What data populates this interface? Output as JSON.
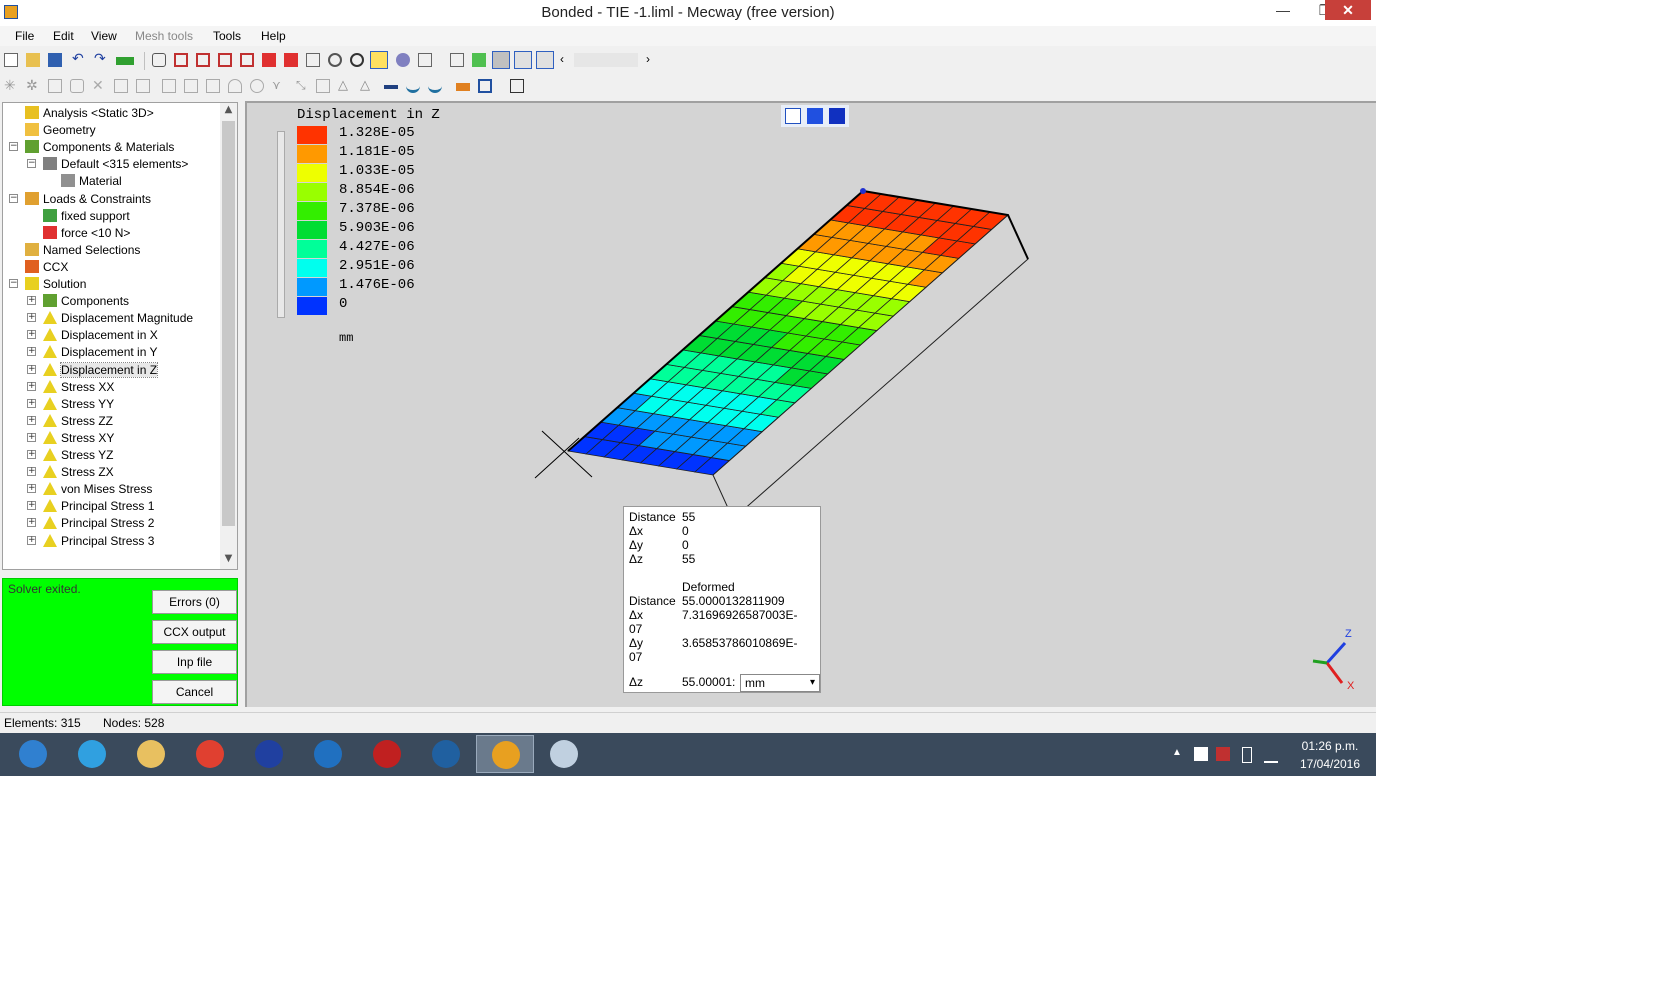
{
  "window": {
    "title": "Bonded - TIE -1.liml - Mecway (free version)",
    "minimize": "—",
    "maximize": "❐",
    "close": "✕"
  },
  "menu": [
    "File",
    "Edit",
    "View",
    "Mesh tools",
    "Tools",
    "Help"
  ],
  "tree": [
    {
      "label": "Analysis <Static 3D>",
      "level": 0,
      "icon": "analysis-icon",
      "color": "#e8c020"
    },
    {
      "label": "Geometry",
      "level": 0,
      "icon": "folder-icon",
      "color": "#f0c040"
    },
    {
      "label": "Components & Materials",
      "level": 0,
      "icon": "components-icon",
      "color": "#60a030",
      "expander": "-"
    },
    {
      "label": "Default <315 elements>",
      "level": 1,
      "icon": "component-icon",
      "color": "#808080",
      "expander": "-"
    },
    {
      "label": "Material",
      "level": 2,
      "icon": "material-icon",
      "color": "#909090"
    },
    {
      "label": "Loads & Constraints",
      "level": 0,
      "icon": "loads-icon",
      "color": "#e0a030",
      "expander": "-"
    },
    {
      "label": "fixed support",
      "level": 1,
      "icon": "fixed-support-icon",
      "color": "#40a040"
    },
    {
      "label": "force <10 N>",
      "level": 1,
      "icon": "force-icon",
      "color": "#e03030"
    },
    {
      "label": "Named Selections",
      "level": 0,
      "icon": "named-selections-icon",
      "color": "#e0b040"
    },
    {
      "label": "CCX",
      "level": 0,
      "icon": "ccx-icon",
      "color": "#e06020"
    },
    {
      "label": "Solution",
      "level": 0,
      "icon": "solution-icon",
      "color": "#e8d020",
      "expander": "-"
    },
    {
      "label": "Components",
      "level": 1,
      "icon": "components-icon",
      "color": "#60a030",
      "expander": "+"
    },
    {
      "label": "Displacement Magnitude",
      "level": 1,
      "icon": "result-icon",
      "color": "#e8d020",
      "expander": "+"
    },
    {
      "label": "Displacement in X",
      "level": 1,
      "icon": "result-icon",
      "color": "#e8d020",
      "expander": "+"
    },
    {
      "label": "Displacement in Y",
      "level": 1,
      "icon": "result-icon",
      "color": "#e8d020",
      "expander": "+"
    },
    {
      "label": "Displacement in Z",
      "level": 1,
      "icon": "result-icon",
      "color": "#e8d020",
      "expander": "+",
      "selected": true
    },
    {
      "label": "Stress XX",
      "level": 1,
      "icon": "result-icon",
      "color": "#e8d020",
      "expander": "+"
    },
    {
      "label": "Stress YY",
      "level": 1,
      "icon": "result-icon",
      "color": "#e8d020",
      "expander": "+"
    },
    {
      "label": "Stress ZZ",
      "level": 1,
      "icon": "result-icon",
      "color": "#e8d020",
      "expander": "+"
    },
    {
      "label": "Stress XY",
      "level": 1,
      "icon": "result-icon",
      "color": "#e8d020",
      "expander": "+"
    },
    {
      "label": "Stress YZ",
      "level": 1,
      "icon": "result-icon",
      "color": "#e8d020",
      "expander": "+"
    },
    {
      "label": "Stress ZX",
      "level": 1,
      "icon": "result-icon",
      "color": "#e8d020",
      "expander": "+"
    },
    {
      "label": "von Mises Stress",
      "level": 1,
      "icon": "result-icon",
      "color": "#e8d020",
      "expander": "+"
    },
    {
      "label": "Principal Stress 1",
      "level": 1,
      "icon": "result-icon",
      "color": "#e8d020",
      "expander": "+"
    },
    {
      "label": "Principal Stress 2",
      "level": 1,
      "icon": "result-icon",
      "color": "#e8d020",
      "expander": "+"
    },
    {
      "label": "Principal Stress 3",
      "level": 1,
      "icon": "result-icon",
      "color": "#e8d020",
      "expander": "+"
    }
  ],
  "solver": {
    "status": "Solver exited.",
    "buttons": [
      "Errors (0)",
      "CCX output",
      "Inp file",
      "Cancel"
    ]
  },
  "legend": {
    "title": "Displacement in Z",
    "unit": "mm",
    "entries": [
      {
        "value": "1.328E-05",
        "color": "#ff3300"
      },
      {
        "value": "1.181E-05",
        "color": "#ff9900"
      },
      {
        "value": "1.033E-05",
        "color": "#eeff00"
      },
      {
        "value": "8.854E-06",
        "color": "#99ff00"
      },
      {
        "value": "7.378E-06",
        "color": "#33ee00"
      },
      {
        "value": "5.903E-06",
        "color": "#00dd33"
      },
      {
        "value": "4.427E-06",
        "color": "#00ff99"
      },
      {
        "value": "2.951E-06",
        "color": "#00ffee"
      },
      {
        "value": "1.476E-06",
        "color": "#0099ff"
      },
      {
        "value": "0",
        "color": "#0033ff"
      }
    ]
  },
  "distance_popup": {
    "distance_label": "Distance",
    "distance": "55",
    "dx_label": "Δx",
    "dx": "0",
    "dy_label": "Δy",
    "dy": "0",
    "dz_label": "Δz",
    "dz": "55",
    "deformed_header": "Deformed",
    "def_distance_label": "Distance",
    "def_distance": "55.0000132811909",
    "def_dx_label": "Δx",
    "def_dx_a": "7.31696926587003E-",
    "def_dx_b": "07",
    "def_dy_label": "Δy",
    "def_dy_a": "3.65853786010869E-",
    "def_dy_b": "07",
    "def_dz_label": "Δz",
    "def_dz": "55.00001:",
    "unit": "mm"
  },
  "axes": {
    "z": "Z",
    "x": "X"
  },
  "status": {
    "elements": "Elements: 315",
    "nodes": "Nodes: 528"
  },
  "taskbar": {
    "apps": [
      {
        "name": "start-button",
        "color": "#3080d0"
      },
      {
        "name": "internet-explorer",
        "color": "#30a0e0"
      },
      {
        "name": "file-explorer",
        "color": "#e8c060"
      },
      {
        "name": "chrome",
        "color": "#e04030"
      },
      {
        "name": "app-blue-arrow",
        "color": "#2040a0"
      },
      {
        "name": "app-ccleaner",
        "color": "#2070c0"
      },
      {
        "name": "app-red-gear",
        "color": "#c02020"
      },
      {
        "name": "app-steam",
        "color": "#2060a0"
      },
      {
        "name": "mecway",
        "color": "#e8a020",
        "active": true
      },
      {
        "name": "paint",
        "color": "#c0d0e0"
      }
    ],
    "time": "01:26 p.m.",
    "date": "17/04/2016"
  }
}
